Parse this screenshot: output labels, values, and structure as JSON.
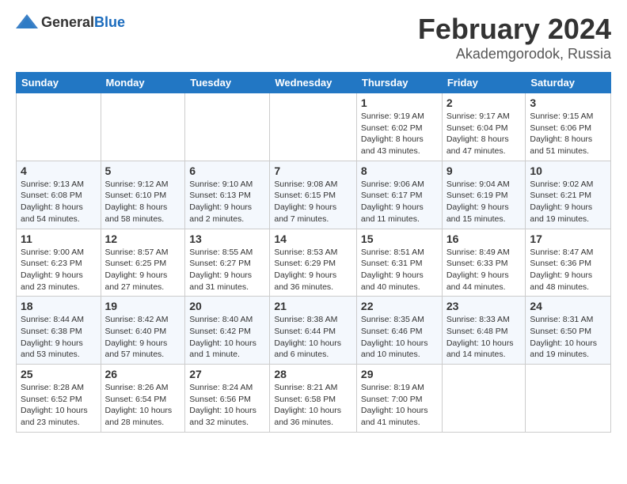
{
  "header": {
    "logo_general": "General",
    "logo_blue": "Blue",
    "main_title": "February 2024",
    "sub_title": "Akademgorodok, Russia"
  },
  "columns": [
    "Sunday",
    "Monday",
    "Tuesday",
    "Wednesday",
    "Thursday",
    "Friday",
    "Saturday"
  ],
  "weeks": [
    [
      {
        "day": "",
        "info": ""
      },
      {
        "day": "",
        "info": ""
      },
      {
        "day": "",
        "info": ""
      },
      {
        "day": "",
        "info": ""
      },
      {
        "day": "1",
        "info": "Sunrise: 9:19 AM\nSunset: 6:02 PM\nDaylight: 8 hours\nand 43 minutes."
      },
      {
        "day": "2",
        "info": "Sunrise: 9:17 AM\nSunset: 6:04 PM\nDaylight: 8 hours\nand 47 minutes."
      },
      {
        "day": "3",
        "info": "Sunrise: 9:15 AM\nSunset: 6:06 PM\nDaylight: 8 hours\nand 51 minutes."
      }
    ],
    [
      {
        "day": "4",
        "info": "Sunrise: 9:13 AM\nSunset: 6:08 PM\nDaylight: 8 hours\nand 54 minutes."
      },
      {
        "day": "5",
        "info": "Sunrise: 9:12 AM\nSunset: 6:10 PM\nDaylight: 8 hours\nand 58 minutes."
      },
      {
        "day": "6",
        "info": "Sunrise: 9:10 AM\nSunset: 6:13 PM\nDaylight: 9 hours\nand 2 minutes."
      },
      {
        "day": "7",
        "info": "Sunrise: 9:08 AM\nSunset: 6:15 PM\nDaylight: 9 hours\nand 7 minutes."
      },
      {
        "day": "8",
        "info": "Sunrise: 9:06 AM\nSunset: 6:17 PM\nDaylight: 9 hours\nand 11 minutes."
      },
      {
        "day": "9",
        "info": "Sunrise: 9:04 AM\nSunset: 6:19 PM\nDaylight: 9 hours\nand 15 minutes."
      },
      {
        "day": "10",
        "info": "Sunrise: 9:02 AM\nSunset: 6:21 PM\nDaylight: 9 hours\nand 19 minutes."
      }
    ],
    [
      {
        "day": "11",
        "info": "Sunrise: 9:00 AM\nSunset: 6:23 PM\nDaylight: 9 hours\nand 23 minutes."
      },
      {
        "day": "12",
        "info": "Sunrise: 8:57 AM\nSunset: 6:25 PM\nDaylight: 9 hours\nand 27 minutes."
      },
      {
        "day": "13",
        "info": "Sunrise: 8:55 AM\nSunset: 6:27 PM\nDaylight: 9 hours\nand 31 minutes."
      },
      {
        "day": "14",
        "info": "Sunrise: 8:53 AM\nSunset: 6:29 PM\nDaylight: 9 hours\nand 36 minutes."
      },
      {
        "day": "15",
        "info": "Sunrise: 8:51 AM\nSunset: 6:31 PM\nDaylight: 9 hours\nand 40 minutes."
      },
      {
        "day": "16",
        "info": "Sunrise: 8:49 AM\nSunset: 6:33 PM\nDaylight: 9 hours\nand 44 minutes."
      },
      {
        "day": "17",
        "info": "Sunrise: 8:47 AM\nSunset: 6:36 PM\nDaylight: 9 hours\nand 48 minutes."
      }
    ],
    [
      {
        "day": "18",
        "info": "Sunrise: 8:44 AM\nSunset: 6:38 PM\nDaylight: 9 hours\nand 53 minutes."
      },
      {
        "day": "19",
        "info": "Sunrise: 8:42 AM\nSunset: 6:40 PM\nDaylight: 9 hours\nand 57 minutes."
      },
      {
        "day": "20",
        "info": "Sunrise: 8:40 AM\nSunset: 6:42 PM\nDaylight: 10 hours\nand 1 minute."
      },
      {
        "day": "21",
        "info": "Sunrise: 8:38 AM\nSunset: 6:44 PM\nDaylight: 10 hours\nand 6 minutes."
      },
      {
        "day": "22",
        "info": "Sunrise: 8:35 AM\nSunset: 6:46 PM\nDaylight: 10 hours\nand 10 minutes."
      },
      {
        "day": "23",
        "info": "Sunrise: 8:33 AM\nSunset: 6:48 PM\nDaylight: 10 hours\nand 14 minutes."
      },
      {
        "day": "24",
        "info": "Sunrise: 8:31 AM\nSunset: 6:50 PM\nDaylight: 10 hours\nand 19 minutes."
      }
    ],
    [
      {
        "day": "25",
        "info": "Sunrise: 8:28 AM\nSunset: 6:52 PM\nDaylight: 10 hours\nand 23 minutes."
      },
      {
        "day": "26",
        "info": "Sunrise: 8:26 AM\nSunset: 6:54 PM\nDaylight: 10 hours\nand 28 minutes."
      },
      {
        "day": "27",
        "info": "Sunrise: 8:24 AM\nSunset: 6:56 PM\nDaylight: 10 hours\nand 32 minutes."
      },
      {
        "day": "28",
        "info": "Sunrise: 8:21 AM\nSunset: 6:58 PM\nDaylight: 10 hours\nand 36 minutes."
      },
      {
        "day": "29",
        "info": "Sunrise: 8:19 AM\nSunset: 7:00 PM\nDaylight: 10 hours\nand 41 minutes."
      },
      {
        "day": "",
        "info": ""
      },
      {
        "day": "",
        "info": ""
      }
    ]
  ]
}
